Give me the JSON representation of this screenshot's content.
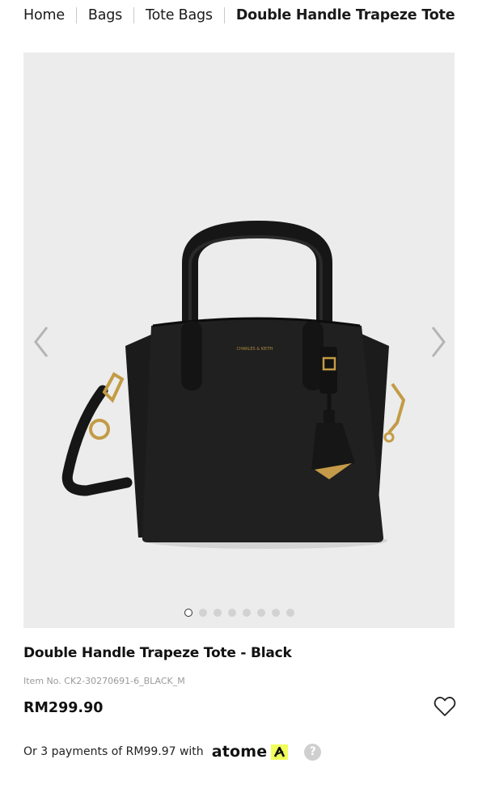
{
  "breadcrumb": {
    "items": [
      "Home",
      "Bags",
      "Tote Bags"
    ],
    "current": "Double Handle Trapeze Tote"
  },
  "gallery": {
    "image_icon": "handbag-photo",
    "brand_print": "CHARLES & KEITH",
    "prev_icon": "chevron-left-icon",
    "next_icon": "chevron-right-icon",
    "total_images": 8,
    "active_index": 0
  },
  "product": {
    "title": "Double Handle Trapeze Tote - Black",
    "item_no": "Item No. CK2-30270691-6_BLACK_M",
    "price": "RM299.90",
    "wishlist_icon": "heart-icon"
  },
  "installment": {
    "text": "Or 3 payments of RM99.97 with",
    "provider": "atome",
    "provider_badge_color": "#f0ff5a",
    "help_label": "?"
  }
}
